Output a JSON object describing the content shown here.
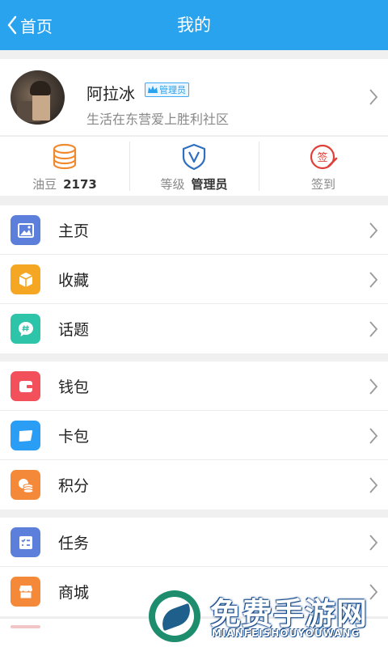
{
  "header": {
    "back_label": "首页",
    "title": "我的"
  },
  "profile": {
    "name": "阿拉冰",
    "badge": "管理员",
    "subtitle": "生活在东营爱上胜利社区"
  },
  "stats": [
    {
      "label": "油豆",
      "value": "2173",
      "icon": "coins-stack-icon",
      "color": "#f08a30"
    },
    {
      "label": "等级",
      "value": "管理员",
      "icon": "v-shield-icon",
      "color": "#2f6fc0"
    },
    {
      "label": "签到",
      "value": "",
      "icon": "sign-in-icon",
      "color": "#e0403a"
    }
  ],
  "menu_groups": [
    [
      {
        "label": "主页",
        "icon": "picture-icon",
        "color": "#5b7fdb"
      },
      {
        "label": "收藏",
        "icon": "box-icon",
        "color": "#f5a623"
      },
      {
        "label": "话题",
        "icon": "hashtag-chat-icon",
        "color": "#2ec4a9"
      }
    ],
    [
      {
        "label": "钱包",
        "icon": "wallet-icon",
        "color": "#f2505a"
      },
      {
        "label": "卡包",
        "icon": "card-icon",
        "color": "#2a9df4"
      },
      {
        "label": "积分",
        "icon": "coins-icon",
        "color": "#f5893a"
      }
    ],
    [
      {
        "label": "任务",
        "icon": "task-list-icon",
        "color": "#5b7fdb"
      },
      {
        "label": "商城",
        "icon": "shop-icon",
        "color": "#f5893a"
      }
    ]
  ],
  "watermark": {
    "big": "免费手游网",
    "small": "MIANFEISHOUYOUWANG"
  }
}
